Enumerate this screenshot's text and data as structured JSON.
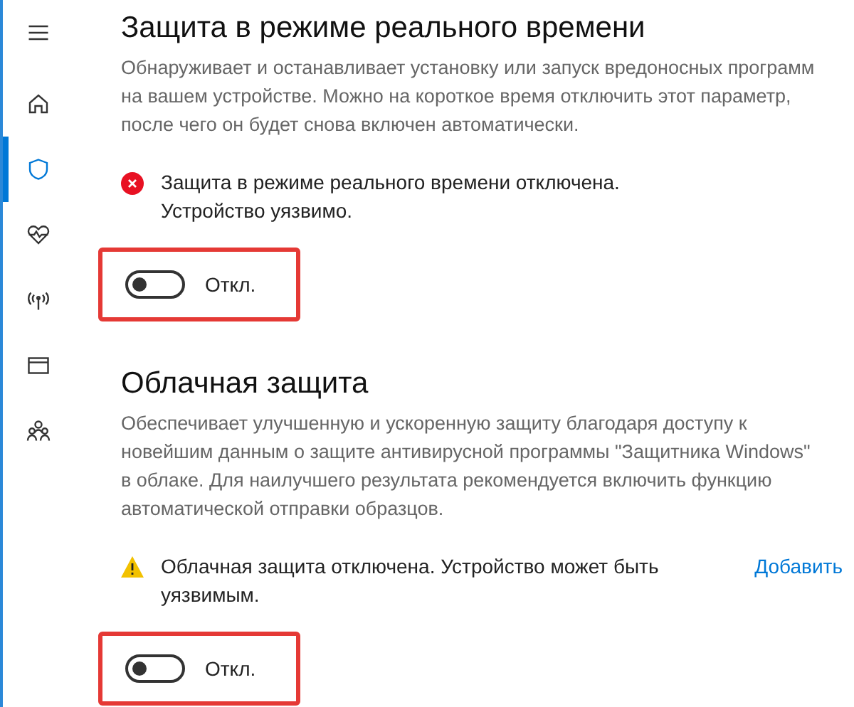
{
  "sidebar": {
    "items": [
      {
        "kind": "menu",
        "selected": false
      },
      {
        "kind": "home",
        "selected": false
      },
      {
        "kind": "shield",
        "selected": true
      },
      {
        "kind": "health",
        "selected": false
      },
      {
        "kind": "network",
        "selected": false
      },
      {
        "kind": "app",
        "selected": false
      },
      {
        "kind": "family",
        "selected": false
      }
    ]
  },
  "sections": [
    {
      "title": "Защита в режиме реального времени",
      "description": "Обнаруживает и останавливает установку или запуск вредоносных программ на вашем устройстве. Можно на короткое время отключить этот параметр, после чего он будет снова включен автоматически.",
      "status": {
        "kind": "error",
        "text": "Защита в режиме реального времени отключена. Устройство уязвимо."
      },
      "toggle": {
        "on": false,
        "label": "Откл.",
        "highlighted": true
      }
    },
    {
      "title": "Облачная защита",
      "description": "Обеспечивает улучшенную и ускоренную защиту благодаря доступу к новейшим данным о защите антивирусной программы \"Защитника Windows\" в облаке. Для наилучшего результата рекомендуется включить функцию автоматической отправки образцов.",
      "status": {
        "kind": "warning",
        "text": "Облачная защита отключена. Устройство может быть уязвимым.",
        "link": "Добавить"
      },
      "toggle": {
        "on": false,
        "label": "Откл.",
        "highlighted": true
      }
    }
  ]
}
